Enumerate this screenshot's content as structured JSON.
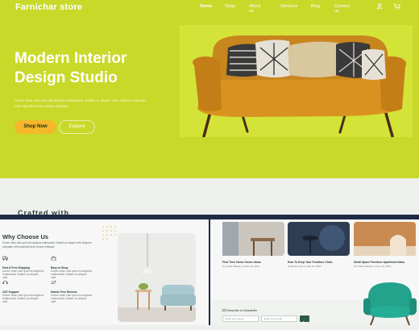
{
  "header": {
    "brand": "Farnichar store",
    "brand_dot": ".",
    "nav": [
      "Home",
      "Shop",
      "About us",
      "Services",
      "Blog",
      "Contact us"
    ]
  },
  "hero": {
    "headline_line1": "Modern Interior",
    "headline_line2": "Design Studio",
    "paragraph": "Donec vitae odio quis nisl dapibus malesuada. Nullam ac aliquet velit. Aliquam vulputate velit imperdiet dolor tempor tristique.",
    "shop_button": "Shop Now",
    "explore_button": "Explore"
  },
  "partial_section": {
    "title_fragment": "Crafted with"
  },
  "why": {
    "title": "Why Choose Us",
    "paragraph": "Donec vitae odio quis nisl dapibus malesuada. Nullam ac aliquet velit. Aliquam vulputate velit imperdiet dolor tempor tristique.",
    "features": [
      {
        "title": "Fast & Free Shipping",
        "desc": "Donec vitae odio quis nisl dapibus malesuada. Nullam ac aliquet velit."
      },
      {
        "title": "Easy to Shop",
        "desc": "Donec vitae odio quis nisl dapibus malesuada. Nullam ac aliquet velit."
      },
      {
        "title": "24/7 Support",
        "desc": "Donec vitae odio quis nisl dapibus malesuada. Nullam ac aliquet velit."
      },
      {
        "title": "Hassle Free Returns",
        "desc": "Donec vitae odio quis nisl dapibus malesuada. Nullam ac aliquet velit."
      }
    ]
  },
  "blog": {
    "posts": [
      {
        "title": "First Time Home Owner Ideas",
        "author": "by Kristin Watson on Dec 19, 2021"
      },
      {
        "title": "How To Keep Your Furniture Clean",
        "author": "by Robert Fox on Dec 15, 2021"
      },
      {
        "title": "Small Space Furniture Apartment Ideas",
        "author": "by Kristin Watson on Dec 12, 2021"
      }
    ]
  },
  "newsletter": {
    "title": "Subscribe to Newsletter",
    "name_placeholder": "Enter your name",
    "email_placeholder": "Enter your email"
  },
  "colors": {
    "hero_bg": "#c8d92a",
    "accent": "#f4b82a",
    "dark_green": "#2f5a46"
  }
}
